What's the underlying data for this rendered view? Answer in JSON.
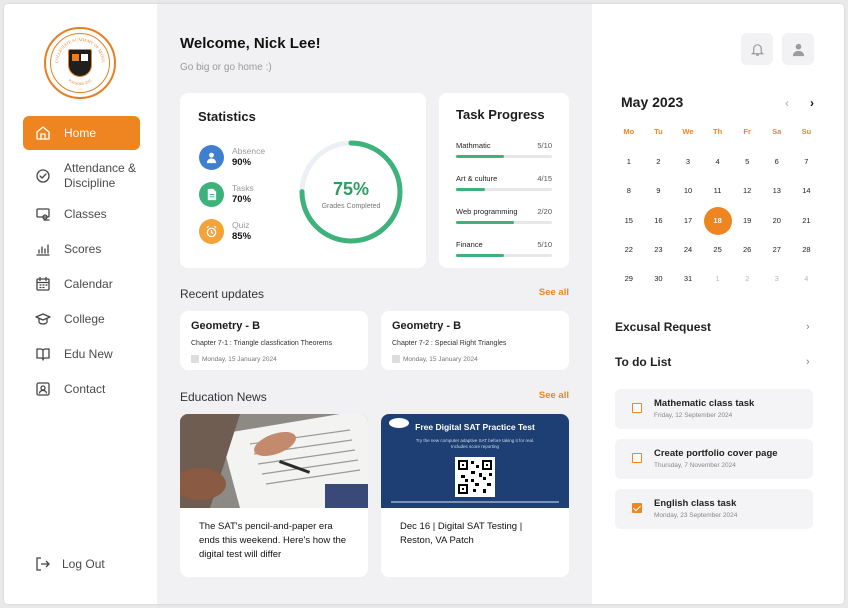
{
  "brand": {
    "logo_ring_top": "COLLEGIATE ACADEMY OF SEOUL",
    "logo_ring_bottom": "FOUNDED 2015",
    "accent": "#ee8521",
    "success": "#3db27a"
  },
  "sidebar": {
    "items": [
      {
        "label": "Home",
        "icon": "home-icon",
        "active": true
      },
      {
        "label": "Attendance & Discipline",
        "icon": "check-circle-icon",
        "active": false
      },
      {
        "label": "Classes",
        "icon": "classes-icon",
        "active": false
      },
      {
        "label": "Scores",
        "icon": "bar-chart-icon",
        "active": false
      },
      {
        "label": "Calendar",
        "icon": "calendar-icon",
        "active": false
      },
      {
        "label": "College",
        "icon": "graduation-cap-icon",
        "active": false
      },
      {
        "label": "Edu New",
        "icon": "book-icon",
        "active": false
      },
      {
        "label": "Contact",
        "icon": "contact-icon",
        "active": false
      }
    ],
    "logout": "Log Out"
  },
  "header": {
    "welcome": "Welcome, Nick Lee!",
    "tagline": "Go big or go home :)"
  },
  "statistics": {
    "title": "Statistics",
    "items": [
      {
        "label": "Absence",
        "value": "90%",
        "color": "#3f7fd0",
        "icon": "user-icon"
      },
      {
        "label": "Tasks",
        "value": "70%",
        "color": "#3db27a",
        "icon": "document-icon"
      },
      {
        "label": "Quiz",
        "value": "85%",
        "color": "#f4a23a",
        "icon": "alarm-icon"
      }
    ],
    "gauge": {
      "value": "75%",
      "fraction": 0.75,
      "label": "Grades Completed"
    }
  },
  "task_progress": {
    "title": "Task Progress",
    "items": [
      {
        "name": "Mathmatic",
        "count": "5/10",
        "fraction": 0.5
      },
      {
        "name": "Art & culture",
        "count": "4/15",
        "fraction": 0.3
      },
      {
        "name": "Web programming",
        "count": "2/20",
        "fraction": 0.6
      },
      {
        "name": "Finance",
        "count": "5/10",
        "fraction": 0.5
      }
    ]
  },
  "recent_updates": {
    "title": "Recent updates",
    "see_all": "See all",
    "items": [
      {
        "title": "Geometry - B",
        "subtitle": "Chapter 7-1 : Triangle classfication Theorems",
        "date": "Monday, 15 January 2024"
      },
      {
        "title": "Geometry - B",
        "subtitle": "Chapter 7-2 : Special Right Triangles",
        "date": "Monday, 15 January 2024"
      }
    ]
  },
  "education_news": {
    "title": "Education News",
    "see_all": "See all",
    "items": [
      {
        "caption": "The SAT's pencil-and-paper era ends this weekend. Here's how the digital test will differ"
      },
      {
        "caption": "Dec 16 | Digital SAT Testing | Reston, VA Patch",
        "poster_title": "Free Digital SAT Practice Test",
        "poster_text": "Try the new computer adaptive SAT before taking it for real. Includes score reporting"
      }
    ]
  },
  "calendar": {
    "month": "May 2023",
    "prev": "‹",
    "next": "›",
    "weekdays": [
      "Mo",
      "Tu",
      "We",
      "Th",
      "Fr",
      "Sa",
      "Su"
    ],
    "days": [
      {
        "d": "1"
      },
      {
        "d": "2"
      },
      {
        "d": "3"
      },
      {
        "d": "4"
      },
      {
        "d": "5"
      },
      {
        "d": "6"
      },
      {
        "d": "7"
      },
      {
        "d": "8"
      },
      {
        "d": "9"
      },
      {
        "d": "10"
      },
      {
        "d": "11"
      },
      {
        "d": "12"
      },
      {
        "d": "13"
      },
      {
        "d": "14"
      },
      {
        "d": "15"
      },
      {
        "d": "16"
      },
      {
        "d": "17"
      },
      {
        "d": "18",
        "selected": true
      },
      {
        "d": "19"
      },
      {
        "d": "20"
      },
      {
        "d": "21"
      },
      {
        "d": "22"
      },
      {
        "d": "23"
      },
      {
        "d": "24"
      },
      {
        "d": "25"
      },
      {
        "d": "26"
      },
      {
        "d": "27"
      },
      {
        "d": "28"
      },
      {
        "d": "29"
      },
      {
        "d": "30"
      },
      {
        "d": "31"
      },
      {
        "d": "1",
        "muted": true
      },
      {
        "d": "2",
        "muted": true
      },
      {
        "d": "3",
        "muted": true
      },
      {
        "d": "4",
        "muted": true
      }
    ]
  },
  "right_panel": {
    "excusal": "Excusal Request",
    "todo_title": "To do List",
    "todos": [
      {
        "title": "Mathematic class task",
        "date": "Friday, 12 September 2024",
        "done": false
      },
      {
        "title": "Create portfolio cover page",
        "date": "Thursday, 7 November 2024",
        "done": false
      },
      {
        "title": "English class task",
        "date": "Monday, 23 September 2024",
        "done": true
      }
    ]
  }
}
